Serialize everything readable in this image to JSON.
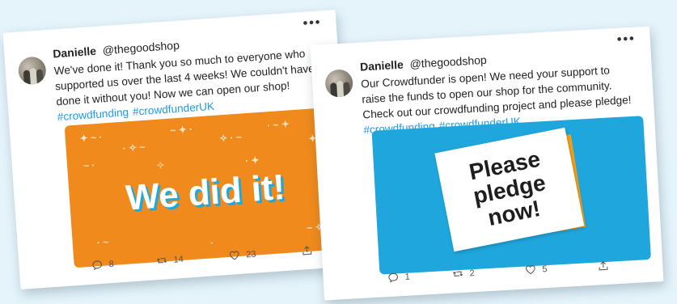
{
  "tweets": [
    {
      "name": "Danielle",
      "handle": "@thegoodshop",
      "text": "We've done it! Thank you so much to everyone who supported us over the last 4 weeks! We couldn't have done it without you! Now we can open our shop!",
      "hashtags": [
        "#crowdfunding",
        "#crowdfunderUK"
      ],
      "media_text": "We did it!",
      "replies": "8",
      "retweets": "14",
      "likes": "23"
    },
    {
      "name": "Danielle",
      "handle": "@thegoodshop",
      "text": "Our Crowdfunder is open! We need your support to raise the funds to open our shop for the community. Check out our crowdfunding project and please pledge!",
      "hashtags": [
        "#crowdfunding",
        "#crowdfunderUK"
      ],
      "media_lines": [
        "Please",
        "pledge",
        "now!"
      ],
      "replies": "1",
      "retweets": "2",
      "likes": "5"
    }
  ],
  "colors": {
    "background": "#e5f4fb",
    "hashtag": "#1d9bf0",
    "orange_banner": "#f08a1c",
    "blue_banner": "#1fa6dc",
    "note_shadow_orange": "#f5a21b"
  },
  "icons": [
    "more-icon",
    "reply-icon",
    "retweet-icon",
    "like-icon",
    "share-icon"
  ]
}
